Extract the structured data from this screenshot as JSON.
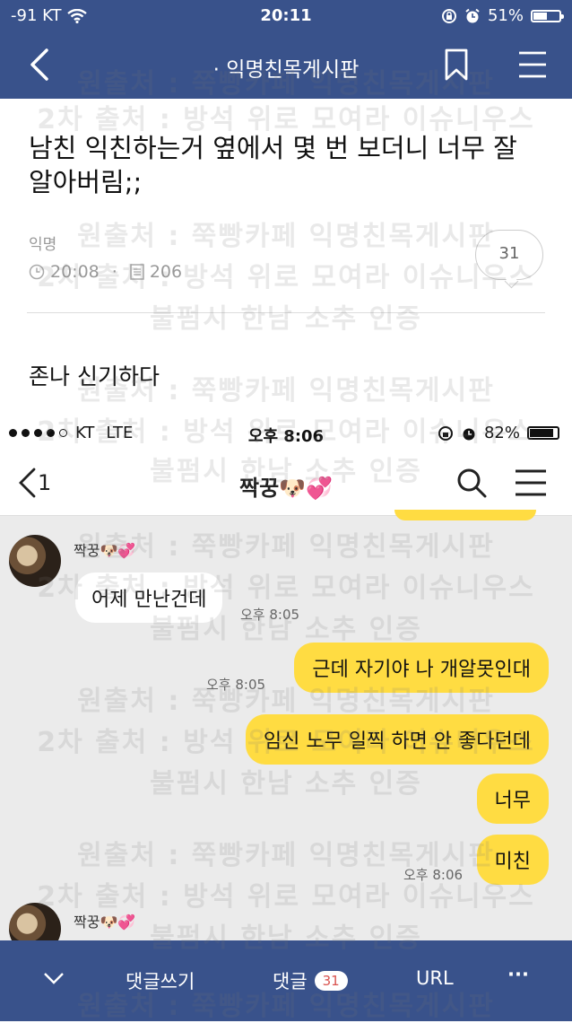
{
  "status_bar": {
    "carrier": "-91 KT",
    "time": "20:11",
    "battery": "51%",
    "battery_level": 0.51
  },
  "nav": {
    "title": "· 익명친목게시판",
    "icons": [
      "back-chevron-icon",
      "bookmark-icon",
      "menu-icon"
    ]
  },
  "post": {
    "title": "남친 익친하는거 옆에서 몇 번 보더니 너무 잘 알아버림;;",
    "author": "익명",
    "time": "20:08",
    "views": "206",
    "comments": "31",
    "body": "존나 신기하다"
  },
  "embedded": {
    "status_bar": {
      "carrier": "KT",
      "network": "LTE",
      "time": "오후 8:06",
      "battery": "82%",
      "battery_level": 0.82
    },
    "nav": {
      "back_count": "1",
      "title": "짝꿍🐶💞"
    },
    "sender": "짝꿍🐶💞",
    "messages": [
      {
        "text": "어제 만난건데",
        "time": "오후 8:05",
        "side": "in"
      },
      {
        "text": "근데 자기야 나 개알못인대",
        "time": "오후 8:05",
        "side": "out"
      },
      {
        "text": "임신 노무 일찍 하면 안 좋다던데",
        "side": "out"
      },
      {
        "text": "너무",
        "side": "out"
      },
      {
        "text": "미친",
        "time": "오후 8:06",
        "side": "out"
      }
    ]
  },
  "toolbar": {
    "collapse_icon": "chevron-down-icon",
    "write_comment": "댓글쓰기",
    "comments_label": "댓글",
    "comments_count": "31",
    "url": "URL",
    "more": "···"
  },
  "watermark": {
    "line1": "원출처 : 쭉빵카페 익명친목게시판",
    "line2": "2차 출처 : 방석 위로 모여라 이슈니우스",
    "line3": "불펌시 한남 소추 인증"
  },
  "colors": {
    "header": "#39528b",
    "out_bubble": "#ffdc42",
    "chat_bg": "#ebebeb"
  }
}
